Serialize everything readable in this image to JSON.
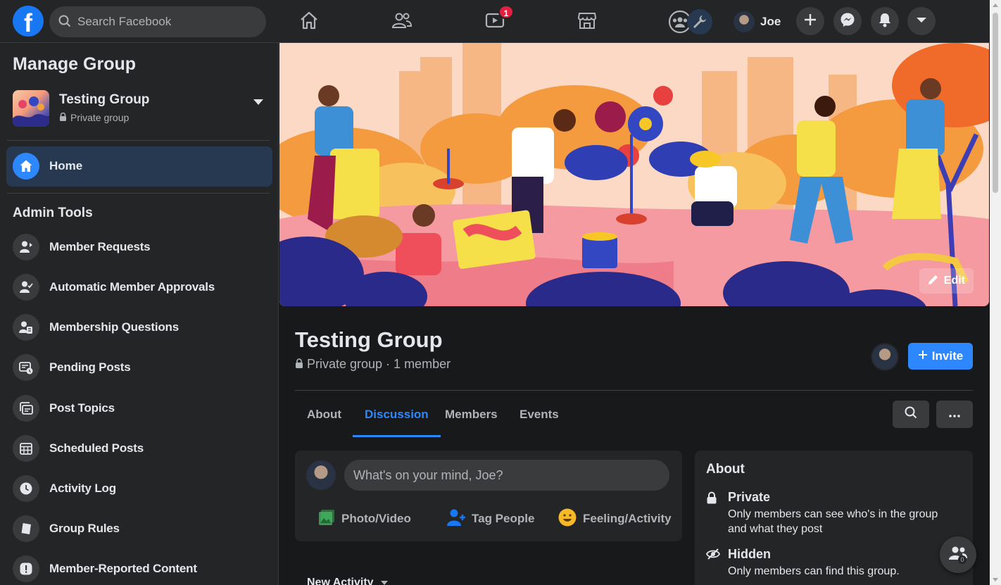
{
  "topbar": {
    "logo": "facebook-logo",
    "search_placeholder": "Search Facebook",
    "nav_icons": [
      "home-icon",
      "friends-icon",
      "watch-icon",
      "marketplace-icon",
      "groups-icon"
    ],
    "watch_badge": "1",
    "profile_name": "Joe",
    "right_buttons": [
      "create-icon",
      "messenger-icon",
      "notifications-icon",
      "account-menu-icon"
    ]
  },
  "sidebar": {
    "title": "Manage Group",
    "group_name": "Testing Group",
    "group_privacy": "Private group",
    "home_label": "Home",
    "section_title": "Admin Tools",
    "items": [
      {
        "label": "Member Requests",
        "icon": "member-requests-icon"
      },
      {
        "label": "Automatic Member Approvals",
        "icon": "auto-approvals-icon"
      },
      {
        "label": "Membership Questions",
        "icon": "membership-questions-icon"
      },
      {
        "label": "Pending Posts",
        "icon": "pending-posts-icon"
      },
      {
        "label": "Post Topics",
        "icon": "post-topics-icon"
      },
      {
        "label": "Scheduled Posts",
        "icon": "scheduled-posts-icon"
      },
      {
        "label": "Activity Log",
        "icon": "clock-icon"
      },
      {
        "label": "Group Rules",
        "icon": "book-icon"
      },
      {
        "label": "Member-Reported Content",
        "icon": "report-icon"
      }
    ]
  },
  "header": {
    "edit_label": "Edit",
    "group_title": "Testing Group",
    "group_meta": "Private group · 1 member",
    "invite_label": "Invite"
  },
  "tabs": [
    {
      "label": "About",
      "active": false
    },
    {
      "label": "Discussion",
      "active": true
    },
    {
      "label": "Members",
      "active": false
    },
    {
      "label": "Events",
      "active": false
    }
  ],
  "composer": {
    "placeholder": "What's on your mind, Joe?",
    "actions": [
      {
        "label": "Photo/Video",
        "icon": "photo-icon"
      },
      {
        "label": "Tag People",
        "icon": "tag-people-icon"
      },
      {
        "label": "Feeling/Activity",
        "icon": "feeling-icon"
      }
    ]
  },
  "about": {
    "title": "About",
    "private_heading": "Private",
    "private_desc": "Only members can see who's in the group and what they post",
    "hidden_heading": "Hidden",
    "hidden_desc": "Only members can find this group."
  },
  "feed": {
    "new_activity_label": "New Activity"
  },
  "floating": {
    "count": "0"
  },
  "colors": {
    "accent": "#2d88ff",
    "surface": "#242526",
    "background": "#18191a",
    "badge": "#e41e3f"
  }
}
